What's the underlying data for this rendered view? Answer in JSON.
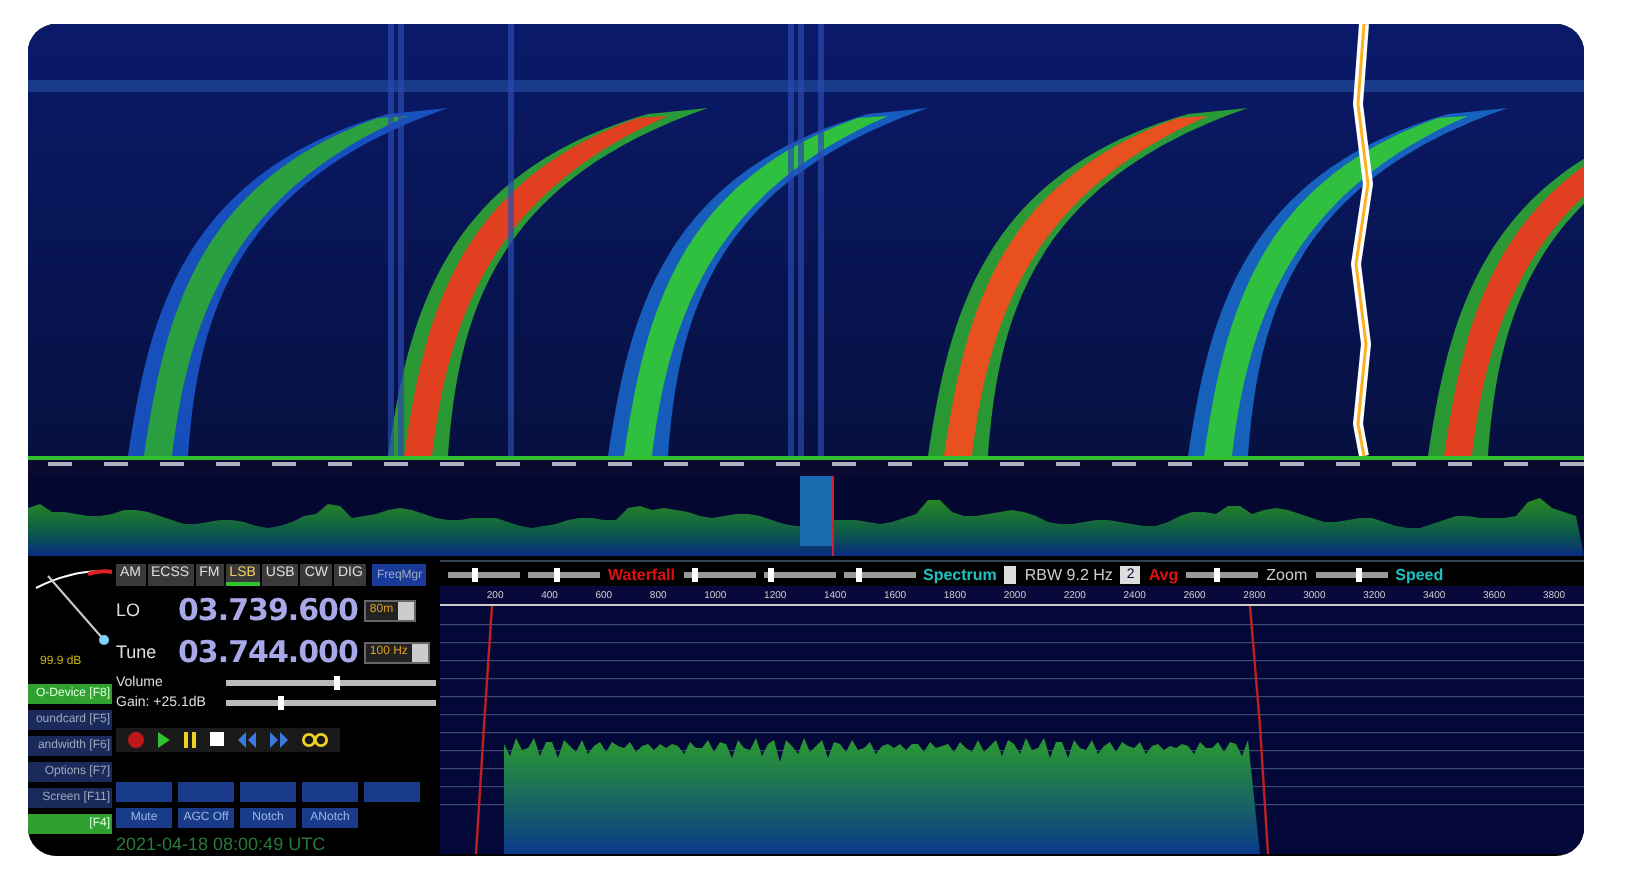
{
  "modes": [
    {
      "label": "AM",
      "selected": false
    },
    {
      "label": "ECSS",
      "selected": false
    },
    {
      "label": "FM",
      "selected": false
    },
    {
      "label": "LSB",
      "selected": true
    },
    {
      "label": "USB",
      "selected": false
    },
    {
      "label": "CW",
      "selected": false
    },
    {
      "label": "DIG",
      "selected": false
    }
  ],
  "freq_manager_button": "FreqMgr",
  "lo": {
    "label": "LO",
    "value": "03.739.600",
    "band": "80m"
  },
  "tune": {
    "label": "Tune",
    "value": "03.744.000",
    "step": "100 Hz"
  },
  "volume": {
    "label": "Volume",
    "level": 0.52
  },
  "gain": {
    "label": "Gain: +25.1dB",
    "level": 0.26
  },
  "s_meter": {
    "reading": "99.9 dB"
  },
  "side_buttons": [
    {
      "label": "O-Device [F8]",
      "selected": true
    },
    {
      "label": "oundcard [F5]",
      "selected": false
    },
    {
      "label": "andwidth [F6]",
      "selected": false
    },
    {
      "label": "Options [F7]",
      "selected": false
    },
    {
      "label": "Screen [F11]",
      "selected": false
    },
    {
      "label": "[F4]",
      "selected": true
    }
  ],
  "dsp_buttons": [
    "Mute",
    "AGC Off",
    "Notch",
    "ANotch"
  ],
  "timestamp": "2021-04-18  08:00:49 UTC",
  "spectrum_toolbar": {
    "waterfall": "Waterfall",
    "spectrum": "Spectrum",
    "rbw": "RBW  9.2 Hz",
    "averaging": "2",
    "avg": "Avg",
    "zoom": "Zoom",
    "speed": "Speed",
    "sliders": [
      {
        "level": 0.35
      },
      {
        "level": 0.4
      },
      {
        "level": 0.15
      },
      {
        "level": 0.1
      },
      {
        "level": 0.2
      },
      {
        "level": 0.4
      },
      {
        "level": 0.6
      }
    ]
  },
  "spectrum_scale": [
    "200",
    "400",
    "600",
    "800",
    "1000",
    "1200",
    "1400",
    "1600",
    "1800",
    "2000",
    "2200",
    "2400",
    "2600",
    "2800",
    "3000",
    "3200",
    "3400",
    "3600",
    "3800"
  ]
}
